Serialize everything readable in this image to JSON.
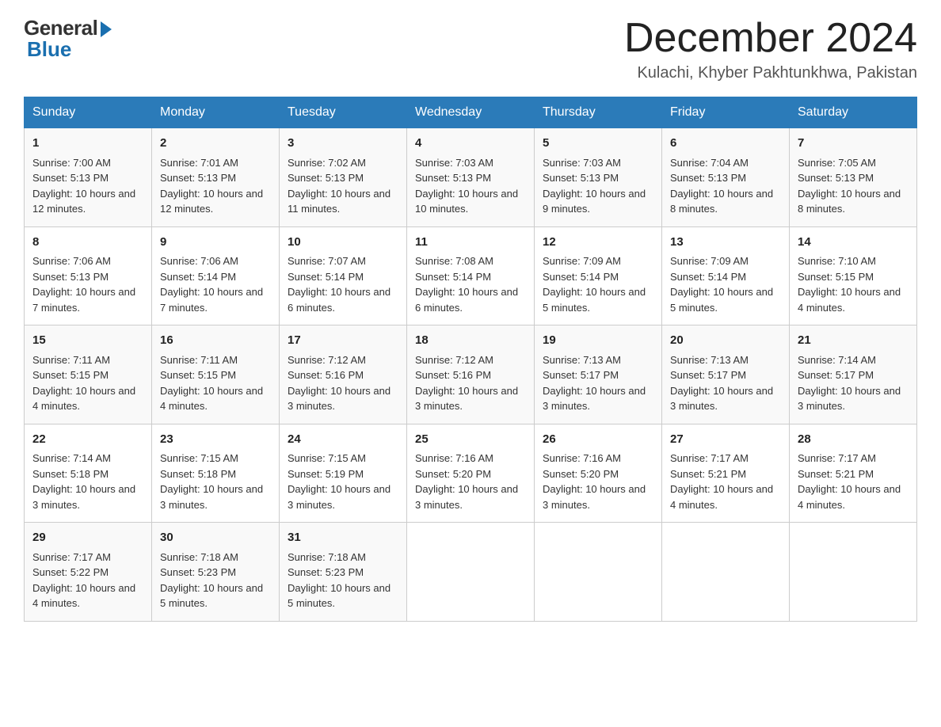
{
  "header": {
    "logo_general": "General",
    "logo_blue": "Blue",
    "month_title": "December 2024",
    "location": "Kulachi, Khyber Pakhtunkhwa, Pakistan"
  },
  "days_of_week": [
    "Sunday",
    "Monday",
    "Tuesday",
    "Wednesday",
    "Thursday",
    "Friday",
    "Saturday"
  ],
  "weeks": [
    [
      {
        "day": "1",
        "sunrise": "7:00 AM",
        "sunset": "5:13 PM",
        "daylight": "10 hours and 12 minutes."
      },
      {
        "day": "2",
        "sunrise": "7:01 AM",
        "sunset": "5:13 PM",
        "daylight": "10 hours and 12 minutes."
      },
      {
        "day": "3",
        "sunrise": "7:02 AM",
        "sunset": "5:13 PM",
        "daylight": "10 hours and 11 minutes."
      },
      {
        "day": "4",
        "sunrise": "7:03 AM",
        "sunset": "5:13 PM",
        "daylight": "10 hours and 10 minutes."
      },
      {
        "day": "5",
        "sunrise": "7:03 AM",
        "sunset": "5:13 PM",
        "daylight": "10 hours and 9 minutes."
      },
      {
        "day": "6",
        "sunrise": "7:04 AM",
        "sunset": "5:13 PM",
        "daylight": "10 hours and 8 minutes."
      },
      {
        "day": "7",
        "sunrise": "7:05 AM",
        "sunset": "5:13 PM",
        "daylight": "10 hours and 8 minutes."
      }
    ],
    [
      {
        "day": "8",
        "sunrise": "7:06 AM",
        "sunset": "5:13 PM",
        "daylight": "10 hours and 7 minutes."
      },
      {
        "day": "9",
        "sunrise": "7:06 AM",
        "sunset": "5:14 PM",
        "daylight": "10 hours and 7 minutes."
      },
      {
        "day": "10",
        "sunrise": "7:07 AM",
        "sunset": "5:14 PM",
        "daylight": "10 hours and 6 minutes."
      },
      {
        "day": "11",
        "sunrise": "7:08 AM",
        "sunset": "5:14 PM",
        "daylight": "10 hours and 6 minutes."
      },
      {
        "day": "12",
        "sunrise": "7:09 AM",
        "sunset": "5:14 PM",
        "daylight": "10 hours and 5 minutes."
      },
      {
        "day": "13",
        "sunrise": "7:09 AM",
        "sunset": "5:14 PM",
        "daylight": "10 hours and 5 minutes."
      },
      {
        "day": "14",
        "sunrise": "7:10 AM",
        "sunset": "5:15 PM",
        "daylight": "10 hours and 4 minutes."
      }
    ],
    [
      {
        "day": "15",
        "sunrise": "7:11 AM",
        "sunset": "5:15 PM",
        "daylight": "10 hours and 4 minutes."
      },
      {
        "day": "16",
        "sunrise": "7:11 AM",
        "sunset": "5:15 PM",
        "daylight": "10 hours and 4 minutes."
      },
      {
        "day": "17",
        "sunrise": "7:12 AM",
        "sunset": "5:16 PM",
        "daylight": "10 hours and 3 minutes."
      },
      {
        "day": "18",
        "sunrise": "7:12 AM",
        "sunset": "5:16 PM",
        "daylight": "10 hours and 3 minutes."
      },
      {
        "day": "19",
        "sunrise": "7:13 AM",
        "sunset": "5:17 PM",
        "daylight": "10 hours and 3 minutes."
      },
      {
        "day": "20",
        "sunrise": "7:13 AM",
        "sunset": "5:17 PM",
        "daylight": "10 hours and 3 minutes."
      },
      {
        "day": "21",
        "sunrise": "7:14 AM",
        "sunset": "5:17 PM",
        "daylight": "10 hours and 3 minutes."
      }
    ],
    [
      {
        "day": "22",
        "sunrise": "7:14 AM",
        "sunset": "5:18 PM",
        "daylight": "10 hours and 3 minutes."
      },
      {
        "day": "23",
        "sunrise": "7:15 AM",
        "sunset": "5:18 PM",
        "daylight": "10 hours and 3 minutes."
      },
      {
        "day": "24",
        "sunrise": "7:15 AM",
        "sunset": "5:19 PM",
        "daylight": "10 hours and 3 minutes."
      },
      {
        "day": "25",
        "sunrise": "7:16 AM",
        "sunset": "5:20 PM",
        "daylight": "10 hours and 3 minutes."
      },
      {
        "day": "26",
        "sunrise": "7:16 AM",
        "sunset": "5:20 PM",
        "daylight": "10 hours and 3 minutes."
      },
      {
        "day": "27",
        "sunrise": "7:17 AM",
        "sunset": "5:21 PM",
        "daylight": "10 hours and 4 minutes."
      },
      {
        "day": "28",
        "sunrise": "7:17 AM",
        "sunset": "5:21 PM",
        "daylight": "10 hours and 4 minutes."
      }
    ],
    [
      {
        "day": "29",
        "sunrise": "7:17 AM",
        "sunset": "5:22 PM",
        "daylight": "10 hours and 4 minutes."
      },
      {
        "day": "30",
        "sunrise": "7:18 AM",
        "sunset": "5:23 PM",
        "daylight": "10 hours and 5 minutes."
      },
      {
        "day": "31",
        "sunrise": "7:18 AM",
        "sunset": "5:23 PM",
        "daylight": "10 hours and 5 minutes."
      },
      null,
      null,
      null,
      null
    ]
  ]
}
